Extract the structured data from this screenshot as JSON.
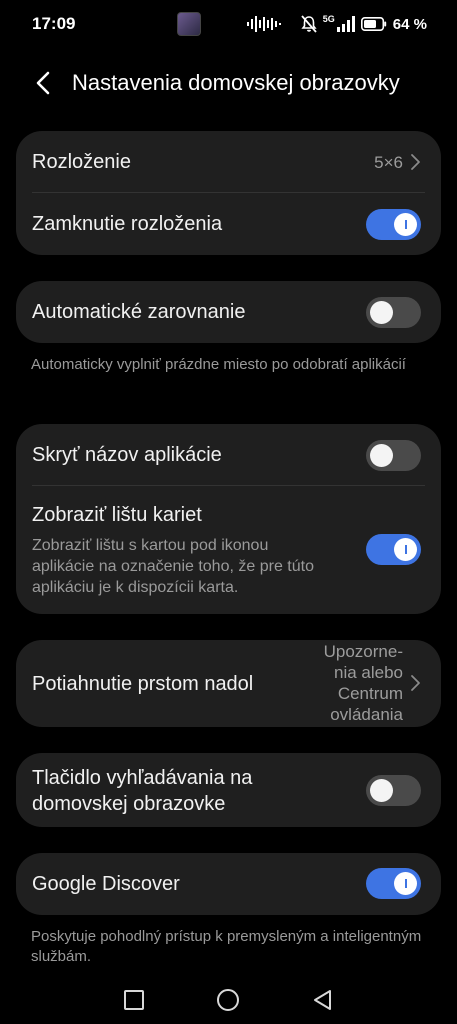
{
  "status_bar": {
    "time": "17:09",
    "network_label": "5G",
    "battery": "64 %",
    "icons": [
      "gallery-thumbnail-icon",
      "sound-wave-icon",
      "mute-icon",
      "signal-icon",
      "battery-icon"
    ]
  },
  "header": {
    "title": "Nastavenia domovskej obrazovky",
    "back_icon": "chevron-left-icon"
  },
  "sections": {
    "layout": {
      "label": "Rozloženie",
      "value": "5×6"
    },
    "lock_layout": {
      "label": "Zamknutie rozloženia",
      "toggle": "on"
    },
    "auto_align": {
      "label": "Automatické zarovnanie",
      "toggle": "off",
      "helper": "Automaticky vyplniť prázdne miesto po odobratí aplikácií"
    },
    "hide_app_name": {
      "label": "Skryť názov aplikácie",
      "toggle": "off"
    },
    "card_bar": {
      "label": "Zobraziť lištu kariet",
      "sub": "Zobraziť lištu s kartou pod ikonou aplikácie na označenie toho, že pre túto aplikáciu je k dispozícii karta.",
      "toggle": "on"
    },
    "swipe_down": {
      "label": "Potiahnutie prstom nadol",
      "value": "Upozorne-\nnia alebo\nCentrum\novládania"
    },
    "search_button": {
      "label": "Tlačidlo vyhľadávania na domovskej obrazovke",
      "toggle": "off"
    },
    "google_discover": {
      "label": "Google Discover",
      "toggle": "on",
      "helper": "Poskytuje pohodlný prístup k premysleným a inteligentným službám."
    }
  },
  "navbar": {
    "buttons": [
      "recents-square-icon",
      "home-circle-icon",
      "back-triangle-icon"
    ]
  },
  "colors": {
    "background": "#000000",
    "card": "#1f1f1f",
    "accent": "#3e74e3",
    "text_primary": "#f1f1f1",
    "text_secondary": "#9a9a9a"
  }
}
